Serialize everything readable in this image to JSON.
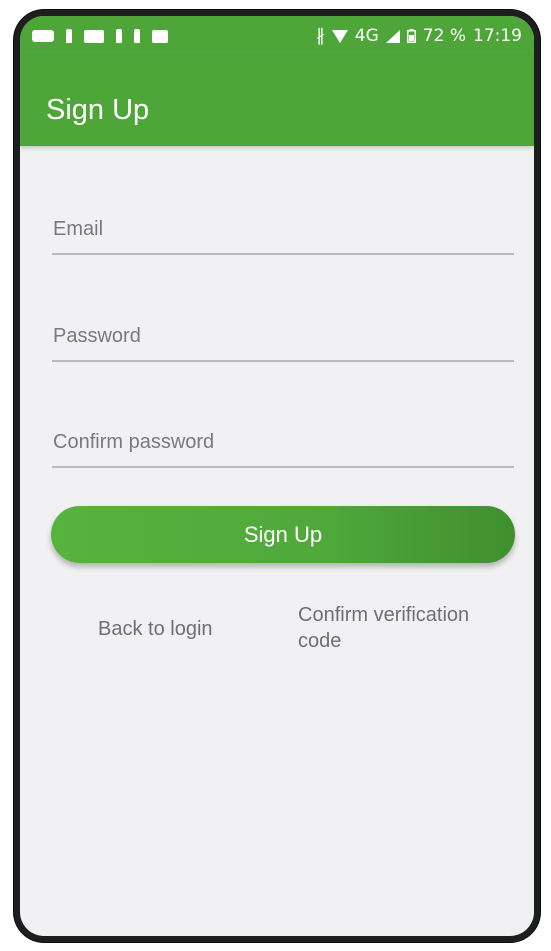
{
  "status_bar": {
    "bluetooth": "∦",
    "network": "4G",
    "battery": "72 %",
    "time": "17:19"
  },
  "app_bar": {
    "title": "Sign Up"
  },
  "form": {
    "email_placeholder": "Email",
    "password_placeholder": "Password",
    "confirm_password_placeholder": "Confirm password",
    "submit_label": "Sign Up"
  },
  "links": {
    "back_to_login": "Back to login",
    "confirm_verification_code": "Confirm verification code"
  },
  "colors": {
    "primary": "#4ea639",
    "background": "#f1f0f2",
    "hint_text": "#7a7a7c"
  }
}
